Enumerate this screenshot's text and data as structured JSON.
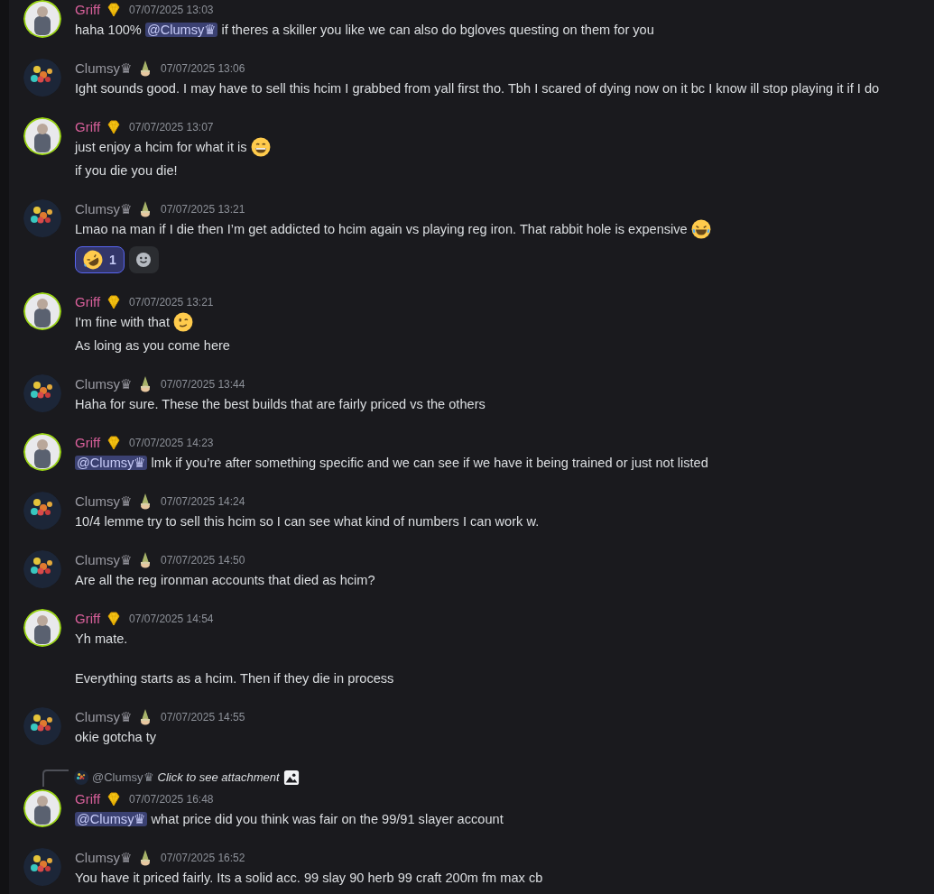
{
  "groups": [
    {
      "author": "Griff",
      "kind": "griff",
      "time": "07/07/2025 13:03",
      "messages": [
        {
          "parts": [
            {
              "kind": "text",
              "text": "haha 100% "
            },
            {
              "kind": "mention",
              "text": "@Clumsy♛"
            },
            {
              "kind": "text",
              "text": " if theres a skiller you like we can also do bgloves questing on them for you"
            }
          ]
        }
      ]
    },
    {
      "author": "Clumsy♛",
      "kind": "clumsy",
      "time": "07/07/2025 13:06",
      "messages": [
        {
          "parts": [
            {
              "kind": "text",
              "text": "Ight sounds good. I may have to sell this hcim I grabbed from yall first tho. Tbh I scared of dying now on it bc I know ill stop playing it if I do"
            }
          ]
        }
      ]
    },
    {
      "author": "Griff",
      "kind": "griff",
      "time": "07/07/2025 13:07",
      "messages": [
        {
          "parts": [
            {
              "kind": "text",
              "text": "just enjoy a hcim for what it is "
            },
            {
              "kind": "grin-emoji"
            }
          ]
        },
        {
          "parts": [
            {
              "kind": "text",
              "text": "if you die you die!"
            }
          ]
        }
      ]
    },
    {
      "author": "Clumsy♛",
      "kind": "clumsy",
      "time": "07/07/2025 13:21",
      "messages": [
        {
          "parts": [
            {
              "kind": "text",
              "text": "Lmao na man if I die then I’m get addicted to hcim again vs playing reg iron. That rabbit hole is expensive "
            },
            {
              "kind": "tears-emoji"
            }
          ],
          "reactions": [
            {
              "count": "1",
              "selected": true
            }
          ]
        }
      ]
    },
    {
      "author": "Griff",
      "kind": "griff",
      "time": "07/07/2025 13:21",
      "messages": [
        {
          "parts": [
            {
              "kind": "text",
              "text": "I'm fine with that "
            },
            {
              "kind": "wink-emoji"
            }
          ]
        },
        {
          "parts": [
            {
              "kind": "text",
              "text": "As loing as you come here"
            }
          ]
        }
      ]
    },
    {
      "author": "Clumsy♛",
      "kind": "clumsy",
      "time": "07/07/2025 13:44",
      "messages": [
        {
          "parts": [
            {
              "kind": "text",
              "text": "Haha for sure. These the best builds that are fairly priced vs the others"
            }
          ]
        }
      ]
    },
    {
      "author": "Griff",
      "kind": "griff",
      "time": "07/07/2025 14:23",
      "messages": [
        {
          "parts": [
            {
              "kind": "mention",
              "text": "@Clumsy♛"
            },
            {
              "kind": "text",
              "text": " lmk if you’re after something specific and we can see if we have it being trained or just not listed"
            }
          ]
        }
      ]
    },
    {
      "author": "Clumsy♛",
      "kind": "clumsy",
      "time": "07/07/2025 14:24",
      "messages": [
        {
          "parts": [
            {
              "kind": "text",
              "text": "10/4 lemme try to sell this hcim so I can see what kind of numbers I can work w."
            }
          ]
        }
      ]
    },
    {
      "author": "Clumsy♛",
      "kind": "clumsy",
      "time": "07/07/2025 14:50",
      "messages": [
        {
          "parts": [
            {
              "kind": "text",
              "text": "Are all the reg ironman accounts that died as hcim?"
            }
          ]
        }
      ]
    },
    {
      "author": "Griff",
      "kind": "griff",
      "time": "07/07/2025 14:54",
      "messages": [
        {
          "parts": [
            {
              "kind": "text",
              "text": "Yh mate.\n\nEverything starts as a hcim. Then if they die in process"
            }
          ]
        }
      ]
    },
    {
      "author": "Clumsy♛",
      "kind": "clumsy",
      "time": "07/07/2025 14:55",
      "messages": [
        {
          "parts": [
            {
              "kind": "text",
              "text": "okie gotcha ty"
            }
          ]
        }
      ]
    },
    {
      "author": "Griff",
      "kind": "griff",
      "time": "07/07/2025 16:48",
      "reply": {
        "author": "@Clumsy♛",
        "kind": "clumsy",
        "text": "Click to see attachment"
      },
      "messages": [
        {
          "parts": [
            {
              "kind": "mention",
              "text": "@Clumsy♛"
            },
            {
              "kind": "text",
              "text": " what price did you think was fair on the 99/91 slayer account"
            }
          ]
        }
      ]
    },
    {
      "author": "Clumsy♛",
      "kind": "clumsy",
      "time": "07/07/2025 16:52",
      "messages": [
        {
          "parts": [
            {
              "kind": "text",
              "text": "You have it priced fairly. Its a solid acc. 99 slay 90 herb 99 craft 200m fm max cb"
            }
          ]
        }
      ]
    }
  ]
}
